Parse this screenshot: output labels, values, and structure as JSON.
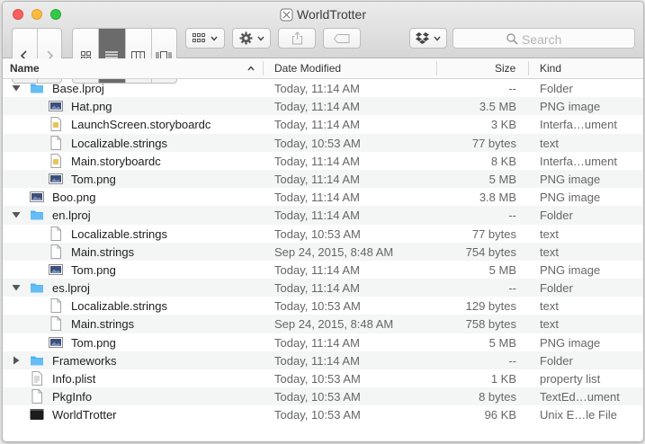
{
  "window": {
    "title": "WorldTrotter",
    "colors": {
      "close": "#fc605c",
      "minimize": "#fdbc40",
      "zoom": "#34c84a",
      "folder": "#52b2f2"
    }
  },
  "toolbar": {
    "back_icon": "chevron-left-icon",
    "forward_icon": "chevron-right-icon",
    "view_modes": [
      "icon-view-icon",
      "list-view-icon",
      "column-view-icon",
      "coverflow-view-icon"
    ],
    "active_view": "list-view-icon",
    "arrange_icon": "grid-arrange-icon",
    "action_icon": "gear-icon",
    "share_icon": "share-icon",
    "tag_icon": "tag-icon",
    "dropbox_icon": "dropbox-icon",
    "search_placeholder": "Search"
  },
  "columns": {
    "name": "Name",
    "date": "Date Modified",
    "size": "Size",
    "kind": "Kind"
  },
  "rows": [
    {
      "name": "Base.lproj",
      "date": "Today, 11:14 AM",
      "size": "--",
      "kind": "Folder",
      "icon": "folder-icon",
      "level": 0,
      "disclosure": "expanded"
    },
    {
      "name": "Hat.png",
      "date": "Today, 11:14 AM",
      "size": "3.5 MB",
      "kind": "PNG image",
      "icon": "image-file-icon",
      "level": 1
    },
    {
      "name": "LaunchScreen.storyboardc",
      "date": "Today, 11:14 AM",
      "size": "3 KB",
      "kind": "Interfa…ument",
      "icon": "storyboard-file-icon",
      "level": 1
    },
    {
      "name": "Localizable.strings",
      "date": "Today, 10:53 AM",
      "size": "77 bytes",
      "kind": "text",
      "icon": "blank-document-icon",
      "level": 1
    },
    {
      "name": "Main.storyboardc",
      "date": "Today, 11:14 AM",
      "size": "8 KB",
      "kind": "Interfa…ument",
      "icon": "storyboard-file-icon",
      "level": 1
    },
    {
      "name": "Tom.png",
      "date": "Today, 11:14 AM",
      "size": "5 MB",
      "kind": "PNG image",
      "icon": "image-file-icon",
      "level": 1
    },
    {
      "name": "Boo.png",
      "date": "Today, 11:14 AM",
      "size": "3.8 MB",
      "kind": "PNG image",
      "icon": "image-file-icon",
      "level": 0
    },
    {
      "name": "en.lproj",
      "date": "Today, 11:14 AM",
      "size": "--",
      "kind": "Folder",
      "icon": "folder-icon",
      "level": 0,
      "disclosure": "expanded"
    },
    {
      "name": "Localizable.strings",
      "date": "Today, 10:53 AM",
      "size": "77 bytes",
      "kind": "text",
      "icon": "blank-document-icon",
      "level": 1
    },
    {
      "name": "Main.strings",
      "date": "Sep 24, 2015, 8:48 AM",
      "size": "754 bytes",
      "kind": "text",
      "icon": "blank-document-icon",
      "level": 1
    },
    {
      "name": "Tom.png",
      "date": "Today, 11:14 AM",
      "size": "5 MB",
      "kind": "PNG image",
      "icon": "image-file-icon",
      "level": 1
    },
    {
      "name": "es.lproj",
      "date": "Today, 11:14 AM",
      "size": "--",
      "kind": "Folder",
      "icon": "folder-icon",
      "level": 0,
      "disclosure": "expanded"
    },
    {
      "name": "Localizable.strings",
      "date": "Today, 10:53 AM",
      "size": "129 bytes",
      "kind": "text",
      "icon": "blank-document-icon",
      "level": 1
    },
    {
      "name": "Main.strings",
      "date": "Sep 24, 2015, 8:48 AM",
      "size": "758 bytes",
      "kind": "text",
      "icon": "blank-document-icon",
      "level": 1
    },
    {
      "name": "Tom.png",
      "date": "Today, 11:14 AM",
      "size": "5 MB",
      "kind": "PNG image",
      "icon": "image-file-icon",
      "level": 1
    },
    {
      "name": "Frameworks",
      "date": "Today, 11:14 AM",
      "size": "--",
      "kind": "Folder",
      "icon": "folder-icon",
      "level": 0,
      "disclosure": "collapsed"
    },
    {
      "name": "Info.plist",
      "date": "Today, 10:53 AM",
      "size": "1 KB",
      "kind": "property list",
      "icon": "plist-file-icon",
      "level": 0
    },
    {
      "name": "PkgInfo",
      "date": "Today, 10:53 AM",
      "size": "8 bytes",
      "kind": "TextEd…ument",
      "icon": "blank-document-icon",
      "level": 0
    },
    {
      "name": "WorldTrotter",
      "date": "Today, 10:53 AM",
      "size": "96 KB",
      "kind": "Unix E…le File",
      "icon": "executable-file-icon",
      "level": 0
    }
  ]
}
